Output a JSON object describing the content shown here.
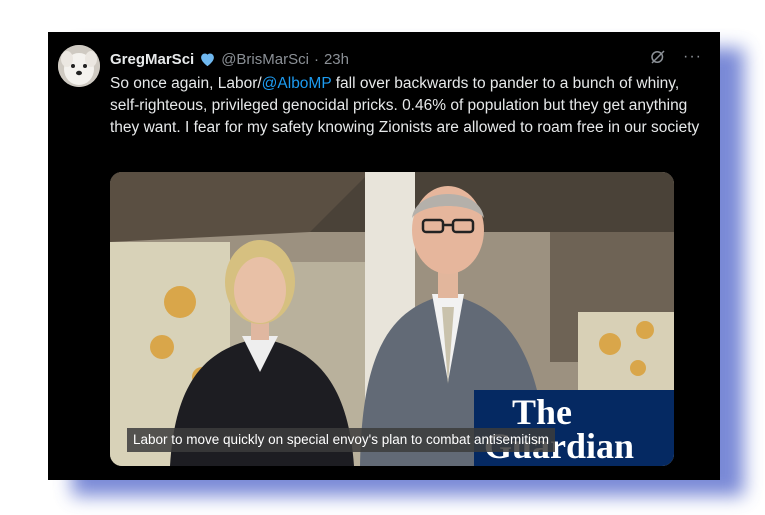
{
  "tweet": {
    "display_name": "GregMarSci",
    "handle": "@BrisMarSci",
    "separator": "·",
    "time": "23h",
    "text_before": "So once again, Labor/",
    "mention": "@AlboMP",
    "text_after": " fall over backwards to pander to a bunch of whiny, self-righteous, privileged genocidal pricks. 0.46% of population but they get anything they want. I fear for my safety knowing Zionists are allowed to roam free in our society",
    "more_menu": "···",
    "icons": [
      "verified-badge-icon",
      "grok-icon",
      "more-icon"
    ]
  },
  "media": {
    "logo_line1": "The",
    "logo_line2": "Guardian",
    "caption": "Labor to move quickly on special envoy's plan to combat antisemitism"
  },
  "colors": {
    "background": "#000000",
    "text": "#e7e9ea",
    "secondary_text": "#8b9096",
    "link": "#1d9bf0",
    "guardian_blue": "#052962",
    "frame_shadow": "#4d62c9"
  }
}
